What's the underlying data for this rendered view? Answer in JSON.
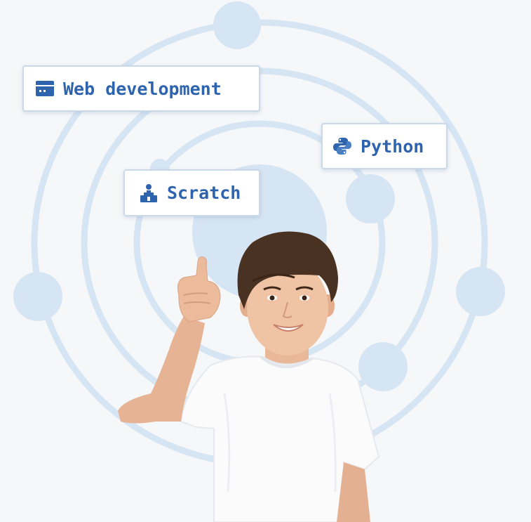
{
  "chips": {
    "web": {
      "label": "Web development",
      "icon": "browser-window-icon"
    },
    "python": {
      "label": "Python",
      "icon": "python-logo-icon"
    },
    "scratch": {
      "label": "Scratch",
      "icon": "person-at-desk-icon"
    }
  },
  "colors": {
    "background": "#f5f7f9",
    "orbit": "#d6e5f3",
    "accent": "#2e63ad",
    "chip_border": "#c9d9ea"
  }
}
